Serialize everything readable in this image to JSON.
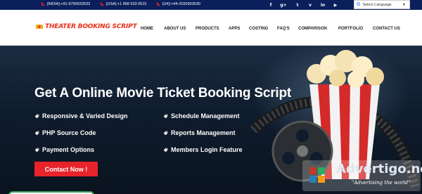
{
  "topbar": {
    "contacts": [
      {
        "label": "[INDIA]:+91-9790033533"
      },
      {
        "label": "[USA]:+1 858 633 0515"
      },
      {
        "label": "[UK]:+44-2032903530"
      }
    ],
    "social_icons": [
      "facebook-icon",
      "google-plus-icon",
      "twitter-icon",
      "vimeo-icon",
      "linkedin-icon",
      "youtube-icon"
    ],
    "social_glyphs": [
      "f",
      "g+",
      "t",
      "v",
      "in",
      "▶"
    ],
    "language": {
      "google_glyph": "G",
      "selected": "Select Language"
    }
  },
  "logo": {
    "text": "THEATER BOOKING SCRIPT"
  },
  "nav": {
    "items": [
      "HOME",
      "ABOUT US",
      "PRODUCTS",
      "APPS",
      "COSTING",
      "FAQ'S",
      "COMPARISON",
      "PORTFOLIO",
      "CONTACT US"
    ]
  },
  "hero": {
    "title": "Get A Online Movie Ticket Booking Script",
    "features_left": [
      "Responsive & Varied Design",
      "PHP Source Code",
      "Payment Options"
    ],
    "features_right": [
      "Schedule Management",
      "Reports Management",
      "Members Login Feature"
    ],
    "cta_label": "Contact Now !"
  },
  "watermark": {
    "name": "Advertigo.net",
    "tagline": "\"Advertising the world\""
  },
  "colors": {
    "topbar": "#0b1f5c",
    "accent": "#e8232a",
    "logo": "#e83018"
  }
}
